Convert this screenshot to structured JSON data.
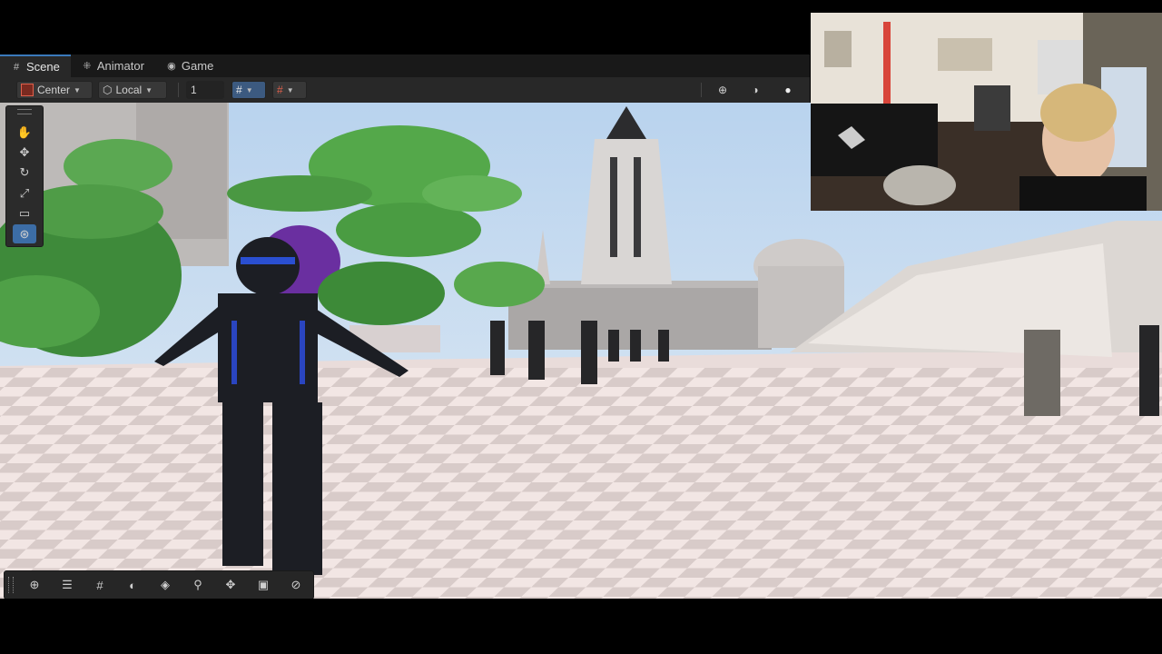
{
  "tabs": [
    {
      "label": "Scene",
      "icon": "grid-hash-icon"
    },
    {
      "label": "Animator",
      "icon": "animator-icon"
    },
    {
      "label": "Game",
      "icon": "gamepad-icon"
    }
  ],
  "toolbar": {
    "pivot": "Center",
    "space": "Local",
    "grid_increment": "1"
  },
  "tools": [
    "hand-tool",
    "move-tool",
    "rotate-tool",
    "scale-tool",
    "rect-tool",
    "transform-tool"
  ],
  "overlay_tools": [
    "view-options",
    "layers",
    "grid",
    "shading",
    "gizmos",
    "search",
    "move",
    "camera",
    "compass"
  ],
  "colors": {
    "accent": "#3c6da6",
    "panel": "#282828",
    "tab_bar": "#191919"
  }
}
